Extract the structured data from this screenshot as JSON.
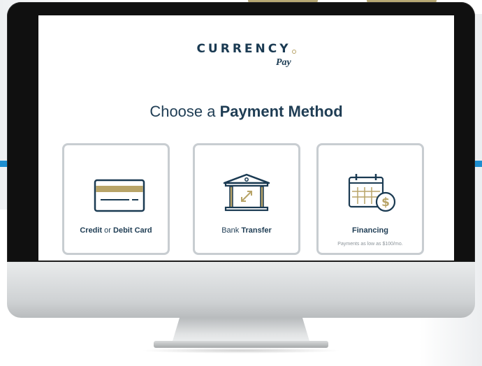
{
  "logo": {
    "word": "CURRENCY",
    "sub": "Pay"
  },
  "heading": {
    "light": "Choose a ",
    "bold": "Payment Method"
  },
  "payment_methods": [
    {
      "icon": "credit-card-icon",
      "label_bold_1": "Credit",
      "label_light_1": " or ",
      "label_bold_2": "Debit Card"
    },
    {
      "icon": "bank-building-icon",
      "label_light_1": "Bank ",
      "label_bold_2": "Transfer"
    },
    {
      "icon": "calendar-dollar-icon",
      "label_bold_1": "Financing",
      "subtitle": "Payments as low as $100/mo."
    }
  ],
  "colors": {
    "navy": "#1a3a52",
    "gold": "#b8a468",
    "card_border": "#c8cdd1",
    "accent_blue": "#1e8ed0"
  }
}
